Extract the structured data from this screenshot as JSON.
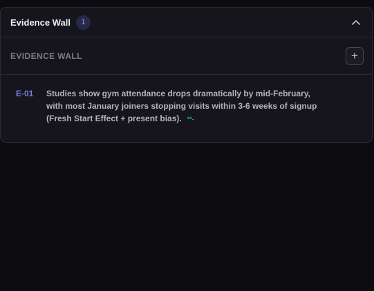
{
  "panel": {
    "title": "Evidence Wall",
    "count": "1",
    "section_title": "EVIDENCE WALL",
    "add_label": "+",
    "collapse_icon": "chevron-up-icon"
  },
  "evidence": [
    {
      "id": "E-01",
      "text": "Studies show gym attendance drops dramatically by mid-February, with most January joiners stopping visits within 3-6 weeks of signup (Fresh Start Effect + present bias).",
      "marker": "**-"
    }
  ],
  "colors": {
    "background": "#0c0c10",
    "panel": "#15151b",
    "accent": "#7582e0",
    "marker": "#1fa58f"
  }
}
